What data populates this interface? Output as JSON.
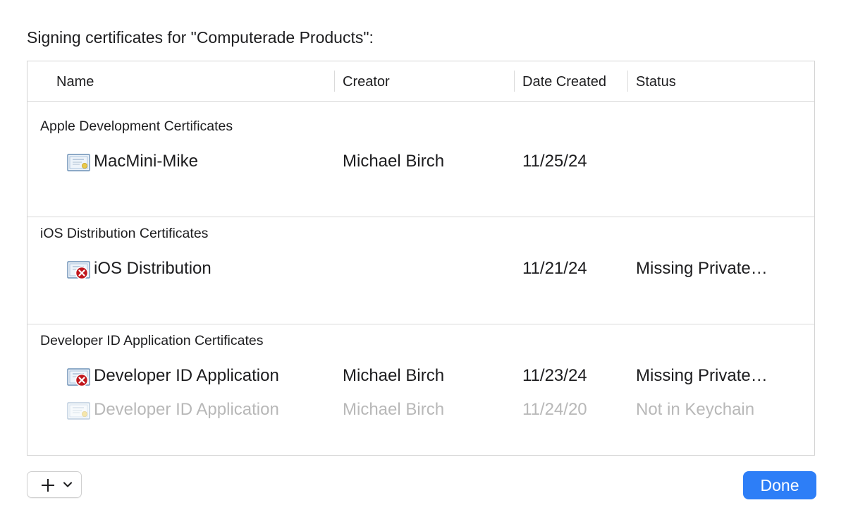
{
  "dialog": {
    "title": "Signing certificates for \"Computerade Products\":"
  },
  "table": {
    "columns": {
      "name": "Name",
      "creator": "Creator",
      "date_created": "Date Created",
      "status": "Status"
    },
    "sections": [
      {
        "title": "Apple Development Certificates",
        "rows": [
          {
            "name": "MacMini-Mike",
            "creator": "Michael Birch",
            "date": "11/25/24",
            "status": "",
            "icon": "certificate-icon",
            "dimmed": false
          }
        ]
      },
      {
        "title": "iOS Distribution Certificates",
        "rows": [
          {
            "name": "iOS Distribution",
            "creator": "",
            "date": "11/21/24",
            "status": "Missing Private…",
            "icon": "certificate-error-icon",
            "dimmed": false
          }
        ]
      },
      {
        "title": "Developer ID Application Certificates",
        "rows": [
          {
            "name": "Developer ID Application",
            "creator": "Michael Birch",
            "date": "11/23/24",
            "status": "Missing Private…",
            "icon": "certificate-error-icon",
            "dimmed": false
          },
          {
            "name": "Developer ID Application",
            "creator": "Michael Birch",
            "date": "11/24/20",
            "status": "Not in Keychain",
            "icon": "certificate-icon",
            "dimmed": true
          }
        ]
      }
    ]
  },
  "footer": {
    "add_icon": "plus-icon",
    "menu_icon": "chevron-down-icon",
    "done_label": "Done"
  },
  "colors": {
    "accent": "#2d7ef7",
    "error": "#c0161c",
    "dimmed_text": "#b8b8b8"
  }
}
